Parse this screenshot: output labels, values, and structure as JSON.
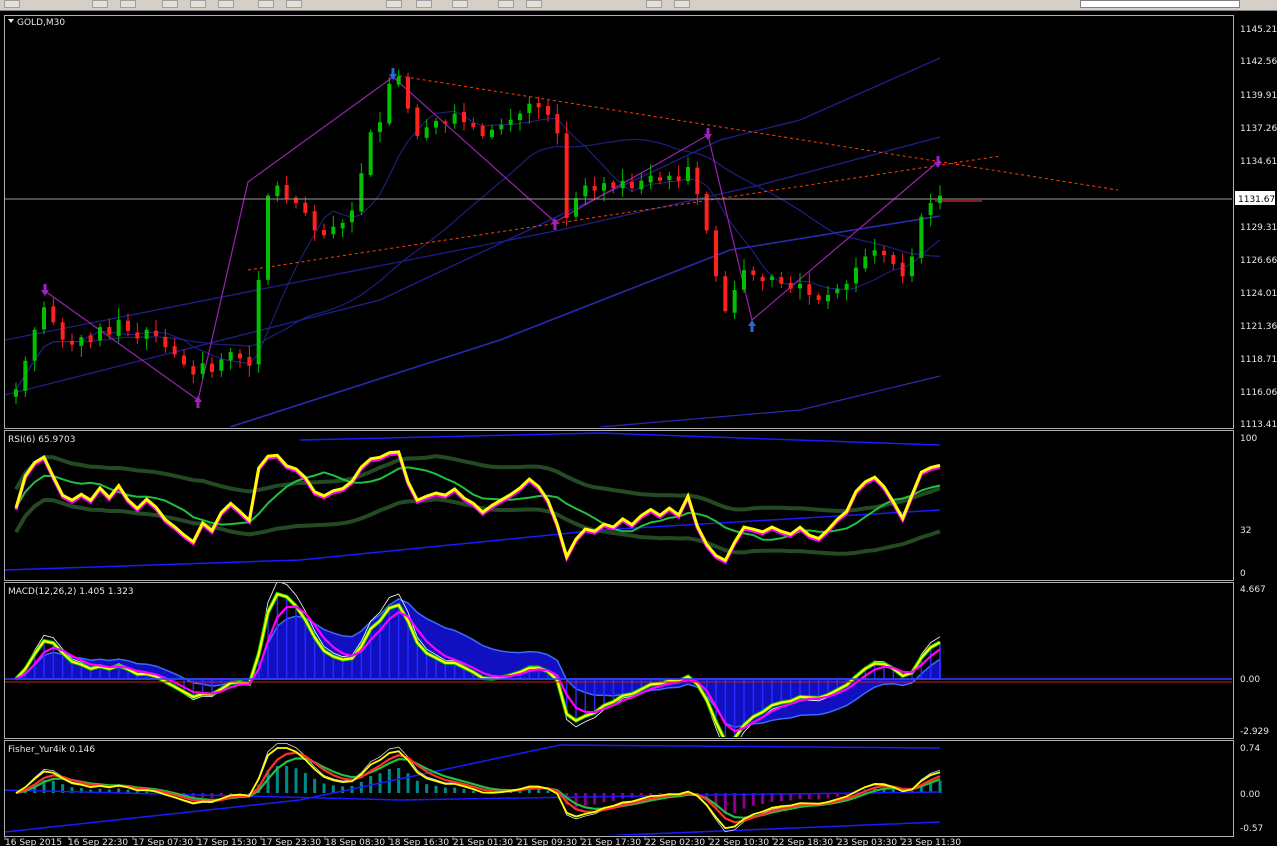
{
  "window": {
    "symbol_title": "GOLD,M30"
  },
  "toolbar": {
    "icons": [
      "new-chart-icon",
      "folder-icon",
      "profiles-icon",
      "window-icon",
      "period-icon",
      "crosshair-icon",
      "line-icon",
      "pencil-icon",
      "add-indicator-icon",
      "autotrading-icon",
      "navigator-icon",
      "cursor-icon",
      "vertical-line-icon",
      "text-icon",
      "fibo-icon"
    ]
  },
  "colors": {
    "background": "#000000",
    "bull_candle": "#00c000",
    "bear_candle": "#ff2020",
    "yellow": "#ffff00",
    "magenta": "#ff00ff",
    "blue": "#1a1aff",
    "green": "#00c000",
    "teal": "#008b8b",
    "purple": "#8b008b",
    "dark_green": "#2a5c2a",
    "trend_line": "#ff4000"
  },
  "price_pane": {
    "axis_labels": [
      "1145.21",
      "1142.56",
      "1139.91",
      "1137.26",
      "1134.61",
      "1131.67",
      "1129.31",
      "1126.66",
      "1124.01",
      "1121.36",
      "1118.71",
      "1116.06",
      "1113.41"
    ],
    "current_price": "1131.67",
    "y_range": [
      1113.41,
      1145.21
    ]
  },
  "rsi_pane": {
    "title": "RSI(6) 65.9703",
    "axis_labels": [
      "100",
      "32",
      "0"
    ]
  },
  "macd_pane": {
    "title": "MACD(12,26,2) 1.405 1.323",
    "axis_labels": [
      "4.667",
      "0.00",
      "-2.929"
    ]
  },
  "osc_pane": {
    "title": "Fisher_Yur4ik 0.146",
    "axis_labels": [
      "0.74",
      "0.00",
      "-0.57"
    ]
  },
  "time_axis": {
    "labels": [
      "16 Sep 2015",
      "16 Sep 22:30",
      "17 Sep 07:30",
      "17 Sep 15:30",
      "17 Sep 23:30",
      "18 Sep 08:30",
      "18 Sep 16:30",
      "21 Sep 01:30",
      "21 Sep 09:30",
      "21 Sep 17:30",
      "22 Sep 02:30",
      "22 Sep 10:30",
      "22 Sep 18:30",
      "23 Sep 03:30",
      "23 Sep 11:30"
    ]
  },
  "chart_data": {
    "type": "candlestick",
    "title": "GOLD,M30",
    "closes": [
      1116.2,
      1118.5,
      1121.0,
      1122.8,
      1121.6,
      1120.2,
      1119.8,
      1120.4,
      1120.0,
      1121.2,
      1120.6,
      1121.8,
      1120.9,
      1120.3,
      1121.0,
      1120.5,
      1119.6,
      1119.0,
      1118.2,
      1117.4,
      1118.3,
      1117.6,
      1118.6,
      1119.2,
      1118.7,
      1118.1,
      1125.0,
      1131.8,
      1132.6,
      1131.5,
      1131.2,
      1130.4,
      1129.0,
      1128.6,
      1129.3,
      1129.6,
      1130.6,
      1133.6,
      1136.9,
      1137.7,
      1140.8,
      1141.4,
      1138.8,
      1136.6,
      1137.3,
      1137.8,
      1137.6,
      1138.4,
      1137.7,
      1137.3,
      1136.6,
      1137.1,
      1137.5,
      1137.9,
      1138.4,
      1139.2,
      1138.9,
      1138.3,
      1136.8,
      1130.0,
      1131.6,
      1132.6,
      1132.2,
      1132.8,
      1132.4,
      1133.0,
      1132.4,
      1133.0,
      1133.4,
      1133.0,
      1133.4,
      1133.0,
      1134.1,
      1131.9,
      1129.0,
      1125.3,
      1122.5,
      1124.2,
      1125.8,
      1125.4,
      1124.9,
      1125.3,
      1124.7,
      1124.3,
      1124.7,
      1123.8,
      1123.4,
      1123.8,
      1124.3,
      1124.7,
      1126.0,
      1126.9,
      1127.4,
      1127.0,
      1126.3,
      1125.3,
      1126.9,
      1130.1,
      1131.2,
      1131.8
    ],
    "y_range": [
      1113.41,
      1145.21
    ],
    "rsi_levels": [
      32,
      100
    ],
    "macd": {
      "value": 1.405,
      "signal": 1.323
    },
    "fisher": 0.146
  }
}
